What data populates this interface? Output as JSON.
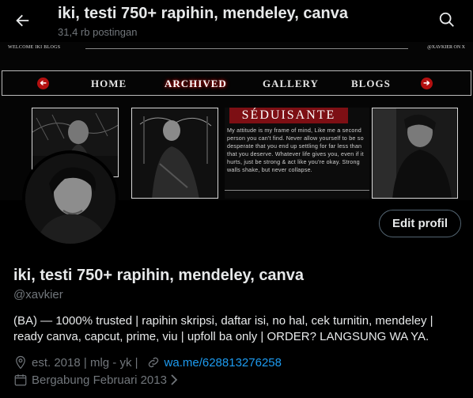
{
  "header": {
    "title": "iki, testi 750+ rapihin, mendeley, canva",
    "subtitle": "31,4 rb postingan"
  },
  "banner": {
    "welcome_left": "WELCOME IKI BLOGS",
    "welcome_right": "@XAVKIER ON X",
    "nav_items": [
      "HOME",
      "ARCHIVED",
      "GALLERY",
      "BLOGS"
    ],
    "active_nav": "ARCHIVED",
    "quote_title": "SÉDUISANTE",
    "quote_text": "My attitude is my frame of mind, Like me a second person you can't find. Never allow yourself to be so desperate that you end up settling for far less than that you deserve. Whatever life gives you, even if it hurts, just be strong & act like you're okay. Strong walls shake, but never collapse.",
    "pin_label": "0",
    "accent": "#b31010"
  },
  "profile": {
    "edit_label": "Edit profil",
    "name": "iki, testi 750+ rapihin, mendeley, canva",
    "handle": "@xavkier",
    "bio": "(BA) — 1000% trusted | rapihin skripsi, daftar isi, no hal, cek turnitin, mendeley | ready canva, capcut, prime, viu | upfoll ba only | ORDER? LANGSUNG WA YA.",
    "location": "est. 2018 | mlg - yk |",
    "website": "wa.me/628813276258",
    "joined": "Bergabung Februari 2013",
    "link_color": "#1d9bf0"
  }
}
